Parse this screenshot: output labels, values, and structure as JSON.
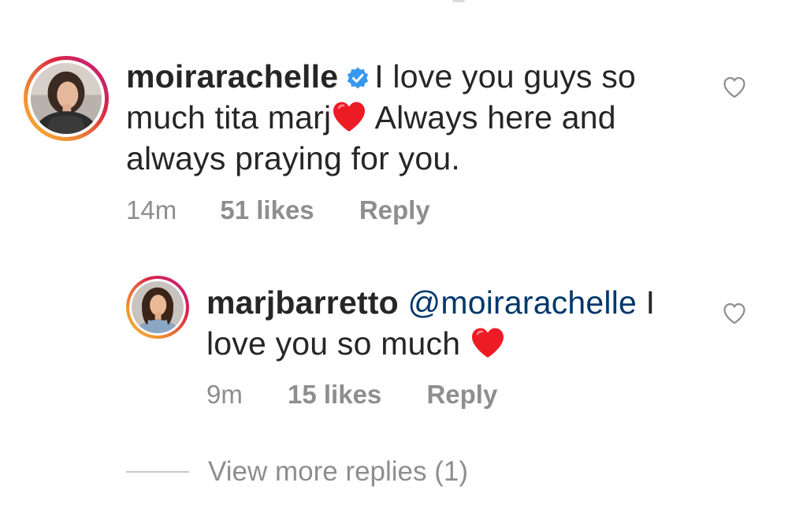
{
  "comments": [
    {
      "username": "moirarachelle",
      "verified": true,
      "text_part1": "I love you guys so much tita marj",
      "emoji": "heart",
      "text_part2": " Always here and always praying for you.",
      "time": "14m",
      "likes": "51 likes",
      "reply_label": "Reply"
    },
    {
      "username": "marjbarretto",
      "verified": false,
      "mention": "@moirarachelle",
      "text_part1": " I love you so much ",
      "emoji": "heart",
      "time": "9m",
      "likes": "15 likes",
      "reply_label": "Reply"
    }
  ],
  "view_more": "View more replies (1)",
  "colors": {
    "text": "#262626",
    "meta": "#8e8e8e",
    "mention": "#00376b",
    "verified": "#3897f0",
    "heart": "#ed1c24"
  },
  "icons": {
    "like": "heart-outline-icon",
    "verified": "verified-badge-icon",
    "emoji": "red-heart-emoji"
  }
}
